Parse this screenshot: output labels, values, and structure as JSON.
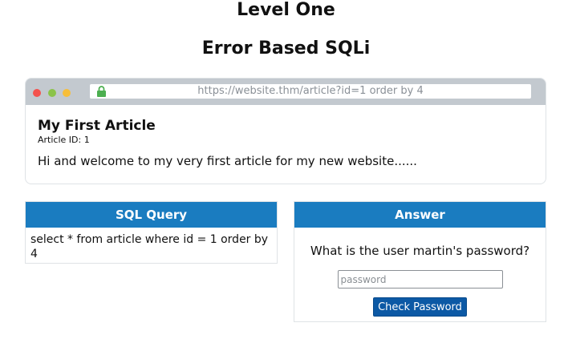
{
  "header": {
    "title": "Level One",
    "subtitle": "Error Based SQLi"
  },
  "browser": {
    "url": "https://website.thm/article?id=1 order by 4",
    "window_dots": [
      {
        "name": "close",
        "color": "#f4524d"
      },
      {
        "name": "maximize",
        "color": "#8bc34a"
      },
      {
        "name": "minimize",
        "color": "#f7be3a"
      }
    ],
    "lock_icon": "lock-icon",
    "lock_color": "#4caf50"
  },
  "article": {
    "title": "My First Article",
    "id_label": "Article ID: 1",
    "body": "Hi and welcome to my very first article for my new website......"
  },
  "sql_panel": {
    "header": "SQL Query",
    "query": "select * from article where id = 1 order by 4"
  },
  "answer_panel": {
    "header": "Answer",
    "question": "What is the user martin's password?",
    "input_placeholder": "password",
    "button_label": "Check Password"
  },
  "colors": {
    "panel_header": "#1a7cc0",
    "button": "#0c59a5",
    "browser_bar": "#c3c9cf"
  }
}
